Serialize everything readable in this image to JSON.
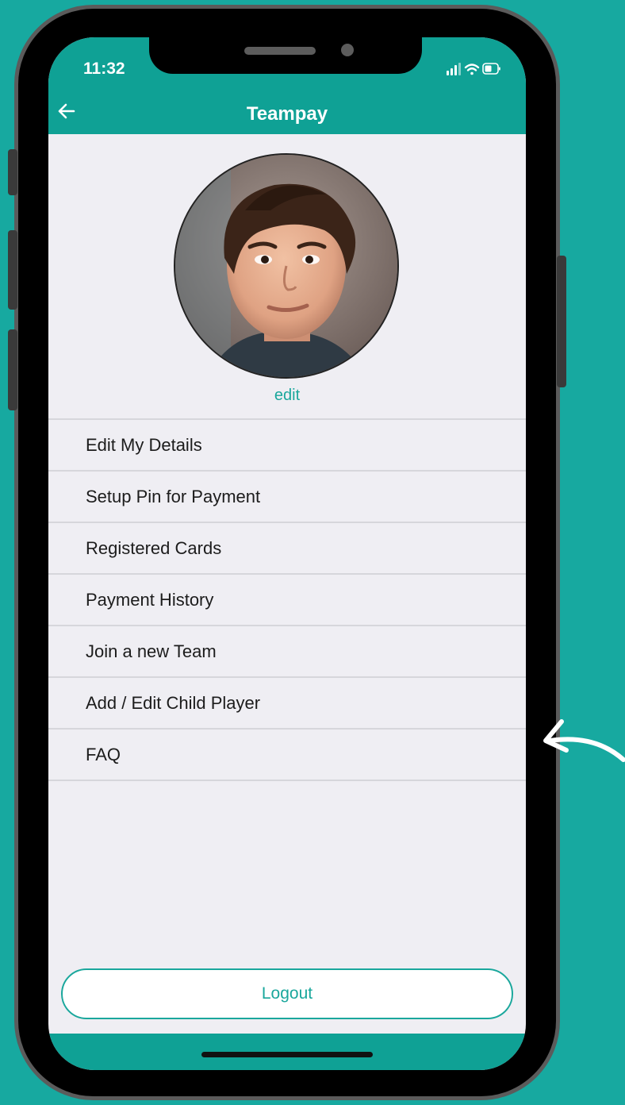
{
  "status_bar": {
    "time": "11:32"
  },
  "header": {
    "title": "Teampay"
  },
  "profile": {
    "edit_label": "edit"
  },
  "menu": {
    "items": [
      {
        "label": "Edit My Details"
      },
      {
        "label": "Setup Pin for Payment"
      },
      {
        "label": "Registered Cards"
      },
      {
        "label": "Payment History"
      },
      {
        "label": "Join a new Team"
      },
      {
        "label": "Add / Edit Child Player"
      },
      {
        "label": "FAQ"
      }
    ]
  },
  "logout": {
    "label": "Logout"
  },
  "colors": {
    "accent": "#0fa195",
    "page_background": "#17a9a0",
    "screen_background": "#efeef3"
  },
  "icons": {
    "back": "arrow-left-icon",
    "signal": "signal-bars-icon",
    "wifi": "wifi-icon",
    "battery": "battery-icon",
    "annotation": "curved-arrow-icon"
  }
}
